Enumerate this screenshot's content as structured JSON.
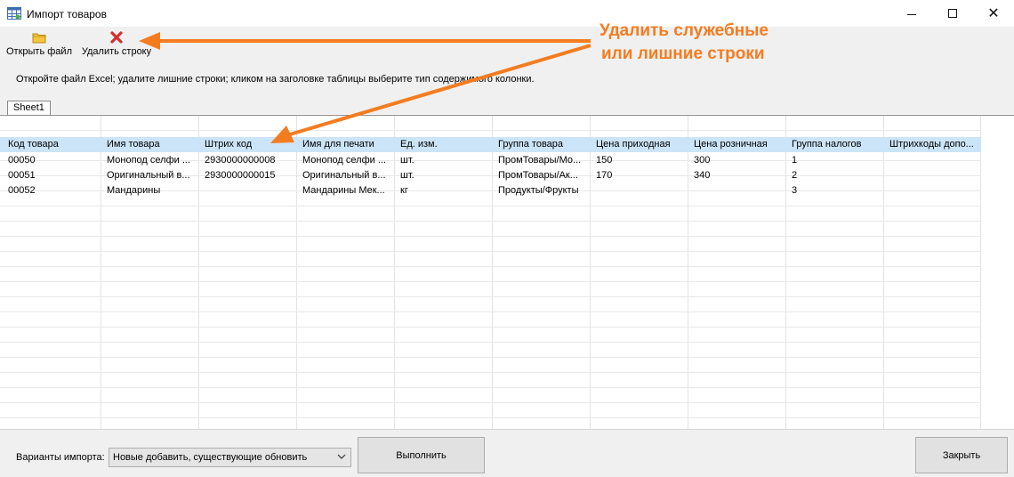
{
  "window": {
    "title": "Импорт товаров",
    "minimize_icon": "minimize-icon",
    "maximize_icon": "maximize-icon",
    "close_glyph": "✕"
  },
  "toolbar": {
    "open_label": "Открыть файл",
    "open_icon": "folder-icon",
    "delete_label": "Удалить строку",
    "delete_icon": "red-x-icon"
  },
  "hint": "Откройте файл Excel;  удалите лишние строки;  кликом на заголовке таблицы выберите тип содержимого колонки.",
  "tabs": [
    {
      "label": "Sheet1"
    }
  ],
  "grid": {
    "headers": [
      "Код товара",
      "Имя товара",
      "Штрих код",
      "Имя для печати",
      "Ед. изм.",
      "Группа товара",
      "Цена приходная",
      "Цена розничная",
      "Группа налогов",
      "Штрихкоды допо..."
    ],
    "rows": [
      [
        "00050",
        "Монопод селфи ...",
        "2930000000008",
        "Монопод селфи ...",
        "шт.",
        "ПромТовары/Мо...",
        "150",
        "300",
        "1",
        ""
      ],
      [
        "00051",
        "Оригинальный в...",
        "2930000000015",
        "Оригинальный в...",
        "шт.",
        "ПромТовары/Ак...",
        "170",
        "340",
        "2",
        ""
      ],
      [
        "00052",
        "Мандарины",
        "",
        "Мандарины Мек...",
        "кг",
        "Продукты/Фрукты",
        "",
        "",
        "3",
        ""
      ]
    ]
  },
  "footer": {
    "import_label": "Варианты импорта:",
    "import_selected": "Новые добавить, существующие обновить",
    "run_label": "Выполнить",
    "close_label": "Закрыть"
  },
  "annotation": {
    "line1": "Удалить служебные",
    "line2": "или лишние строки",
    "color": "#f47c20"
  },
  "colors": {
    "header_row": "#cce4f7",
    "toolbar_bg": "#f0f0f0"
  }
}
